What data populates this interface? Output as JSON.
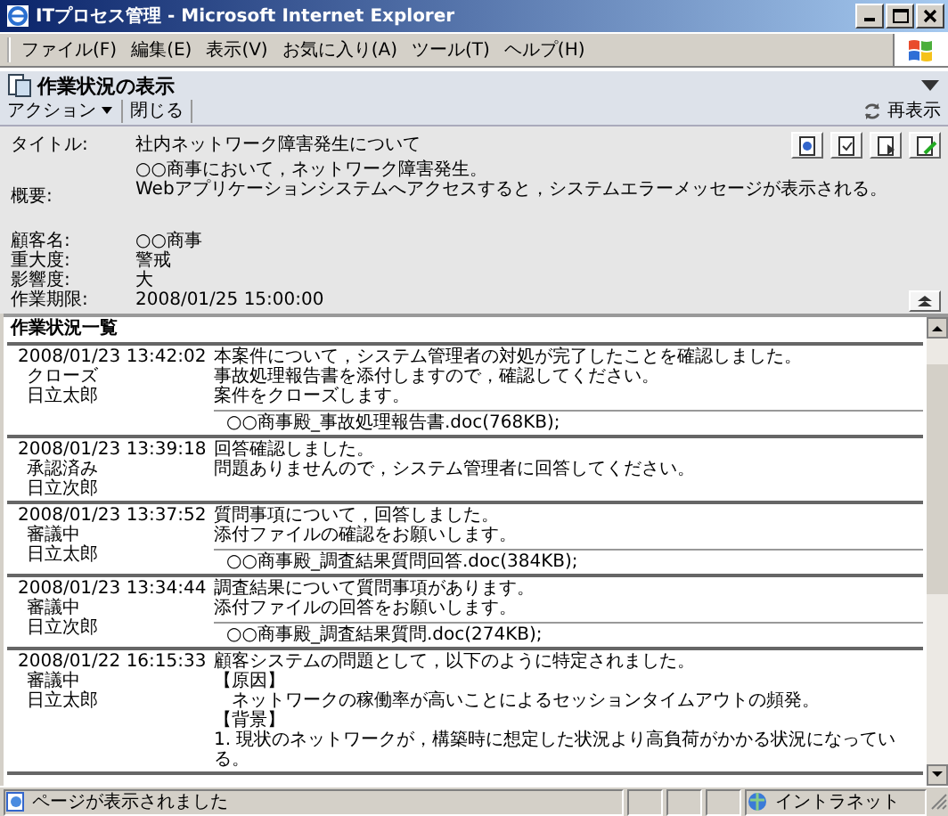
{
  "window": {
    "title": "ITプロセス管理 - Microsoft Internet Explorer"
  },
  "menu": [
    "ファイル(F)",
    "編集(E)",
    "表示(V)",
    "お気に入り(A)",
    "ツール(T)",
    "ヘルプ(H)"
  ],
  "page": {
    "title": "作業状況の表示",
    "refresh": "再表示",
    "toolbar": [
      {
        "label": "アクション",
        "kind": "dropdown"
      },
      {
        "label": "閉じる",
        "kind": "button"
      }
    ]
  },
  "details": [
    {
      "label": "タイトル:",
      "lines": [
        "社内ネットワーク障害発生について"
      ],
      "kind": "title"
    },
    {
      "label": "概要:",
      "lines": [
        "○○商事において，ネットワーク障害発生。",
        "Webアプリケーションシステムへアクセスすると，システムエラーメッセージが表示される。"
      ],
      "kind": "summary"
    },
    {
      "label": "顧客名:",
      "lines": [
        "○○商事"
      ],
      "kind": "field"
    },
    {
      "label": "重大度:",
      "lines": [
        "警戒"
      ],
      "kind": "field"
    },
    {
      "label": "影響度:",
      "lines": [
        "大"
      ],
      "kind": "field"
    },
    {
      "label": "作業期限:",
      "lines": [
        "2008/01/25 15:00:00"
      ],
      "kind": "field"
    }
  ],
  "list": {
    "title": "作業状況一覧",
    "entries": [
      {
        "datetime": "2008/01/23 13:42:02",
        "status": "クローズ",
        "person": "日立太郎",
        "message": [
          "本案件について，システム管理者の対処が完了したことを確認しました。",
          "事故処理報告書を添付しますので，確認してください。",
          "案件をクローズします。"
        ],
        "attachment": "○○商事殿_事故処理報告書.doc(768KB);"
      },
      {
        "datetime": "2008/01/23 13:39:18",
        "status": "承認済み",
        "person": "日立次郎",
        "message": [
          "回答確認しました。",
          "問題ありませんので，システム管理者に回答してください。"
        ]
      },
      {
        "datetime": "2008/01/23 13:37:52",
        "status": "審議中",
        "person": "日立太郎",
        "message": [
          "質問事項について，回答しました。",
          "添付ファイルの確認をお願いします。"
        ],
        "attachment": "○○商事殿_調査結果質問回答.doc(384KB);"
      },
      {
        "datetime": "2008/01/23 13:34:44",
        "status": "審議中",
        "person": "日立次郎",
        "message": [
          "調査結果について質問事項があります。",
          "添付ファイルの回答をお願いします。"
        ],
        "attachment": "○○商事殿_調査結果質問.doc(274KB);"
      },
      {
        "datetime": "2008/01/22 16:15:33",
        "status": "審議中",
        "person": "日立太郎",
        "message": [
          "顧客システムの問題として，以下のように特定されました。",
          "【原因】",
          "　ネットワークの稼働率が高いことによるセッションタイムアウトの頻発。",
          "【背景】",
          "1. 現状のネットワークが，構築時に想定した状況より高負荷がかかる状況になっている。"
        ]
      }
    ]
  },
  "status_bar": {
    "message": "ページが表示されました",
    "zone": "イントラネット"
  }
}
